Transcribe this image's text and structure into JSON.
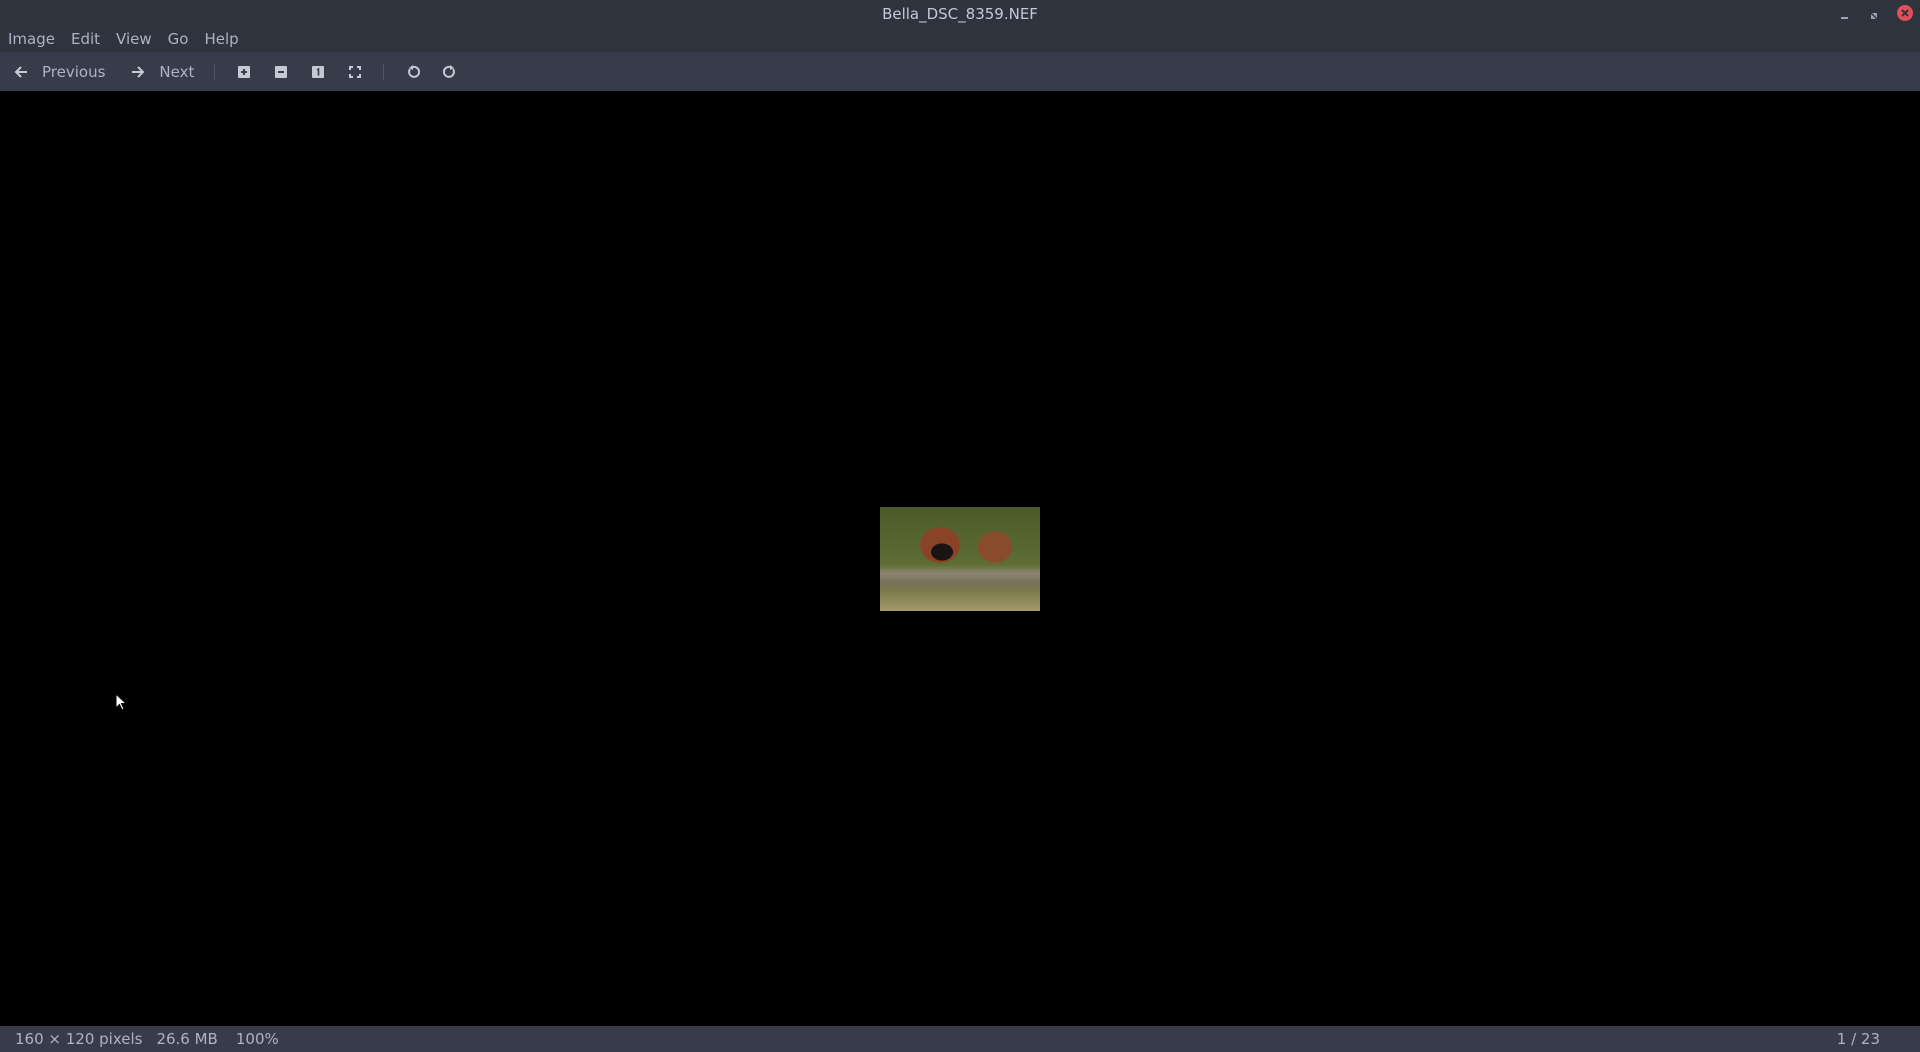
{
  "window": {
    "title": "Bella_DSC_8359.NEF"
  },
  "menu": [
    "Image",
    "Edit",
    "View",
    "Go",
    "Help"
  ],
  "toolbar": {
    "previous": "Previous",
    "next": "Next"
  },
  "status": {
    "dimensions": "160 × 120 pixels",
    "size": "26.6 MB",
    "zoom": "100%",
    "position": "1 / 23"
  },
  "colors": {
    "close": "#e0505a",
    "chrome": "#2f333d",
    "toolbar": "#383c4a"
  }
}
